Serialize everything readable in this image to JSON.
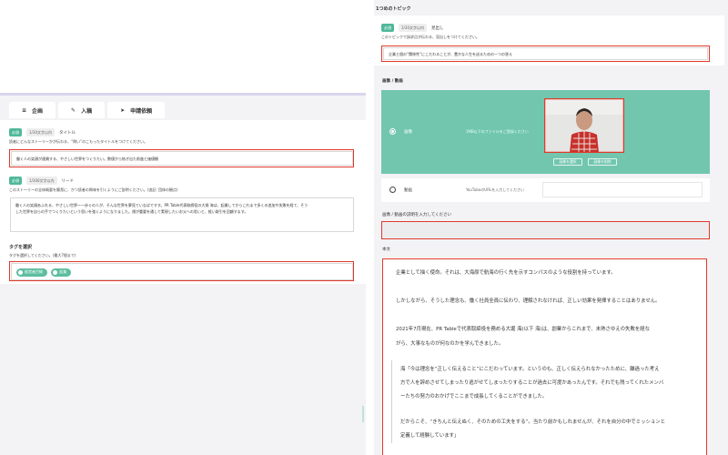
{
  "tabs": [
    {
      "icon": "≡",
      "label": "企画"
    },
    {
      "icon": "✎",
      "label": "入稿"
    },
    {
      "icon": "➤",
      "label": "申請依頼"
    }
  ],
  "title_field": {
    "badge": "必須",
    "count": "1/30文字以内",
    "label": "タイトル",
    "description": "読者にどんなストーリーかが伝わる、“問い”のこもったタイトルをつけてください。",
    "value": "働く人の笑顔が連鎖する、やさしい世界をつくりたい。数値から紡ぎ出た前進と価値観"
  },
  "lead_field": {
    "badge": "必須",
    "count": "1/300文字以内",
    "label": "リード",
    "description": "このストーリーの全体概要を簡潔に、かつ読者の興味を引くようにご説明ください。(追記: 団体の観点)",
    "value_line1": "働く人の笑顔あふれる、やさしい世界ー一歩ぐの人が、そんな世界を夢見ていなばですす。PR Table代表取締役の大堀 海は、起業してからこれまで多くの追加や失敗を経て、そう",
    "value_line2": "した世界を自らの手でつくりたいという思いを強くようになりました。規が重要を通して実現したいお父への思いと、経い取引を回顧すます。"
  },
  "tags": {
    "title": "タグを選択",
    "description": "タグを選択してください。(最大7個まで)",
    "items": [
      "経営者目線",
      "起業"
    ]
  },
  "right": {
    "section_title": "1つめのトピック",
    "topic_field": {
      "badge": "必須",
      "count": "1/30文字以内",
      "label": "見出し",
      "description": "このトピックで訴求点が伝わる、見出しをつけてください。",
      "value": "企業と個の“関係性”にこだわることが、豊かな人生を送るための一つの答え"
    },
    "media_title": "画像 / 動画",
    "image_option": {
      "label": "画像",
      "hint": "1MB以下のファイルをご登録ください",
      "btn_select": "画像を選択",
      "btn_delete": "画像を削除"
    },
    "video_option": {
      "label": "動画",
      "hint": "YouTubeのURLを入力してください"
    },
    "media_desc_label": "画像 / 動画の説明を入力してください",
    "body_label": "本文",
    "body_paragraphs": [
      "企業として描く使命。それは、大海原で航海の行く先を示すコンパスのような役割を持っています。",
      "しかしながら、そうした理念も、働く社員全員に伝わり、理解されなければ、正しい効果を発揮することはありません。",
      "2021年7月現在、PR Tableで代表取締役を務める大堀 海(以下 海)は、創業からこれまで、未熟さゆえの失敗を経な",
      "がら、大事なものが何なのかを学んできました。",
      "海「今は理念を“正しく伝えること”にこだわっています。というのも、正しく伝えられなかったために、離過った考え",
      "方で人を辞めさせてしまったり逃がせてしまったりすることが過去に可度かあったんです。それでも残ってくれたメンバ",
      "ーたちの努力のおかげでここまで成長してくることができました。",
      "だからこそ、“きちんと伝えぬく、そのための工夫をする”。当たり前かもしれませんが、それを自分の中でミッションと",
      "定義して経験しています」"
    ]
  },
  "colors": {
    "accent_green": "#72c6ae",
    "badge_green": "#4fb89a",
    "highlight_red": "#e0392b"
  }
}
